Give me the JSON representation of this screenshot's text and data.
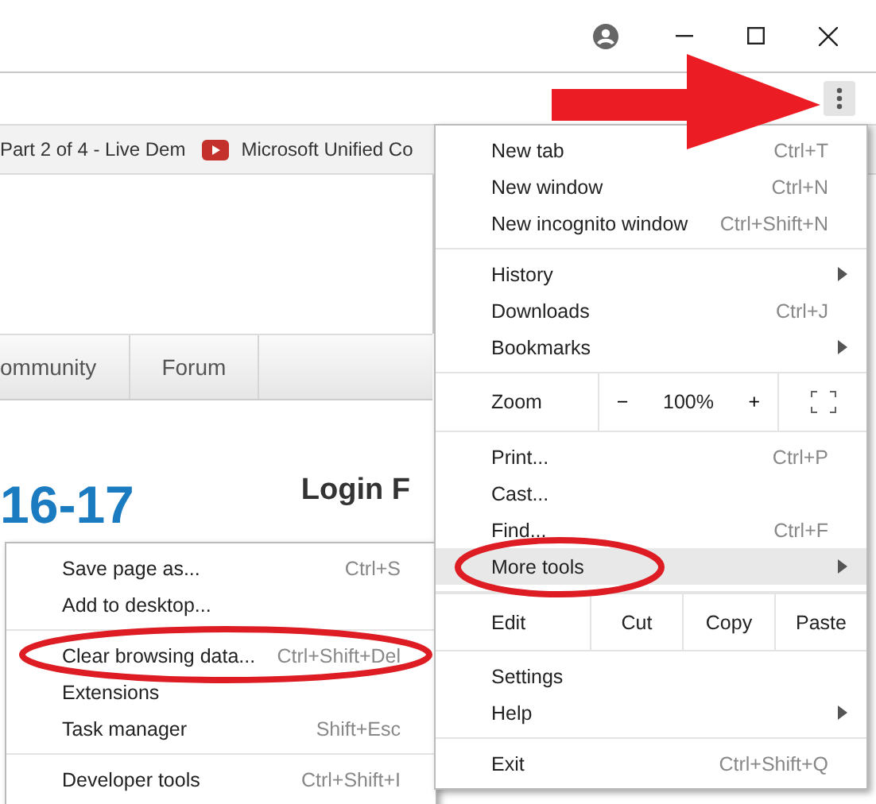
{
  "bookmarks_bar": [
    {
      "label": "Part 2 of 4 - Live Dem",
      "kind": "plain"
    },
    {
      "label": "Microsoft Unified Co",
      "kind": "video"
    }
  ],
  "page": {
    "nav_tabs": [
      "ommunity",
      "Forum"
    ],
    "heading": "16-17",
    "login_title": "Login F"
  },
  "menu": {
    "sections": [
      {
        "kind": "items",
        "items": [
          {
            "label": "New tab",
            "shortcut": "Ctrl+T",
            "submenu": false,
            "highlighted": false
          },
          {
            "label": "New window",
            "shortcut": "Ctrl+N",
            "submenu": false,
            "highlighted": false
          },
          {
            "label": "New incognito window",
            "shortcut": "Ctrl+Shift+N",
            "submenu": false,
            "highlighted": false
          }
        ]
      },
      {
        "kind": "items",
        "items": [
          {
            "label": "History",
            "submenu": true,
            "highlighted": false
          },
          {
            "label": "Downloads",
            "shortcut": "Ctrl+J",
            "submenu": false,
            "highlighted": false
          },
          {
            "label": "Bookmarks",
            "submenu": true,
            "highlighted": false
          }
        ]
      },
      {
        "kind": "zoom",
        "label": "Zoom",
        "minus": "−",
        "value": "100%",
        "plus": "+"
      },
      {
        "kind": "items",
        "items": [
          {
            "label": "Print...",
            "shortcut": "Ctrl+P",
            "submenu": false,
            "highlighted": false
          },
          {
            "label": "Cast...",
            "submenu": false,
            "highlighted": false
          },
          {
            "label": "Find...",
            "shortcut": "Ctrl+F",
            "submenu": false,
            "highlighted": false
          },
          {
            "label": "More tools",
            "submenu": true,
            "highlighted": true
          }
        ]
      },
      {
        "kind": "edit",
        "label": "Edit",
        "buttons": [
          "Cut",
          "Copy",
          "Paste"
        ]
      },
      {
        "kind": "items",
        "items": [
          {
            "label": "Settings",
            "submenu": false,
            "highlighted": false
          },
          {
            "label": "Help",
            "submenu": true,
            "highlighted": false
          }
        ]
      },
      {
        "kind": "items",
        "items": [
          {
            "label": "Exit",
            "shortcut": "Ctrl+Shift+Q",
            "submenu": false,
            "highlighted": false
          }
        ]
      }
    ]
  },
  "more_tools_menu": {
    "sections": [
      [
        {
          "label": "Save page as...",
          "shortcut": "Ctrl+S"
        },
        {
          "label": "Add to desktop..."
        }
      ],
      [
        {
          "label": "Clear browsing data...",
          "shortcut": "Ctrl+Shift+Del"
        },
        {
          "label": "Extensions"
        },
        {
          "label": "Task manager",
          "shortcut": "Shift+Esc"
        }
      ],
      [
        {
          "label": "Developer tools",
          "shortcut": "Ctrl+Shift+I"
        }
      ]
    ]
  }
}
